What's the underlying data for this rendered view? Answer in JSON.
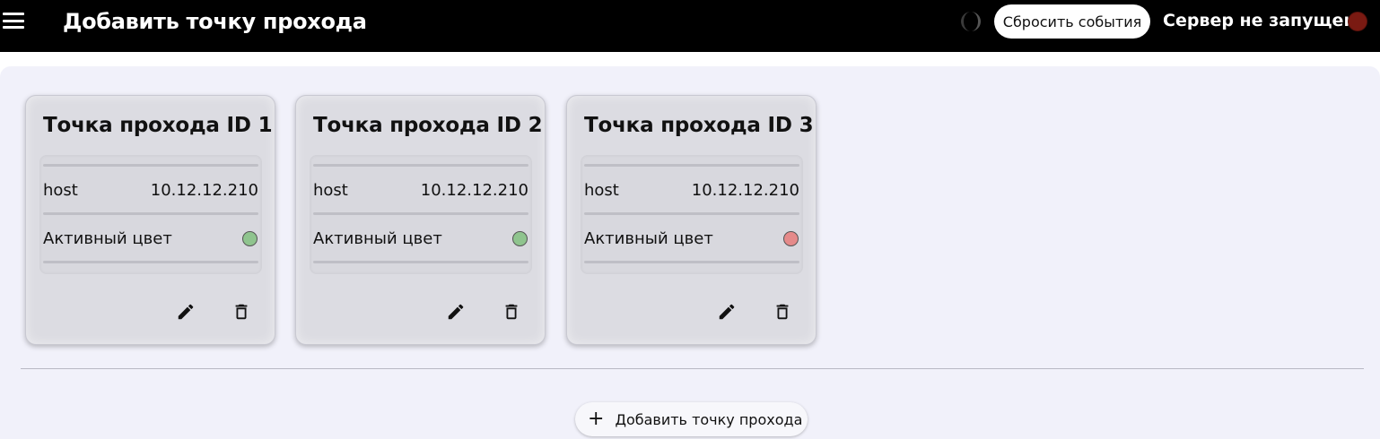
{
  "header": {
    "title": "Добавить точку прохода",
    "reset_label": "Сбросить события",
    "server_status": "Сервер не запущен",
    "server_status_color": "#7a1a12"
  },
  "icons": {
    "menu": "menu-icon",
    "theme": "moon-icon",
    "edit": "pencil-icon",
    "delete": "trash-icon",
    "add": "plus-icon"
  },
  "cards": [
    {
      "title": "Точка прохода ID 1",
      "host_label": "host",
      "host_value": "10.12.12.210",
      "color_label": "Активный цвет",
      "color": "#8fc48e"
    },
    {
      "title": "Точка прохода ID 2",
      "host_label": "host",
      "host_value": "10.12.12.210",
      "color_label": "Активный цвет",
      "color": "#8fc48e"
    },
    {
      "title": "Точка прохода ID 3",
      "host_label": "host",
      "host_value": "10.12.12.210",
      "color_label": "Активный цвет",
      "color": "#e58a8a"
    }
  ],
  "add_button": {
    "plus": "+",
    "label": "Добавить точку прохода"
  }
}
